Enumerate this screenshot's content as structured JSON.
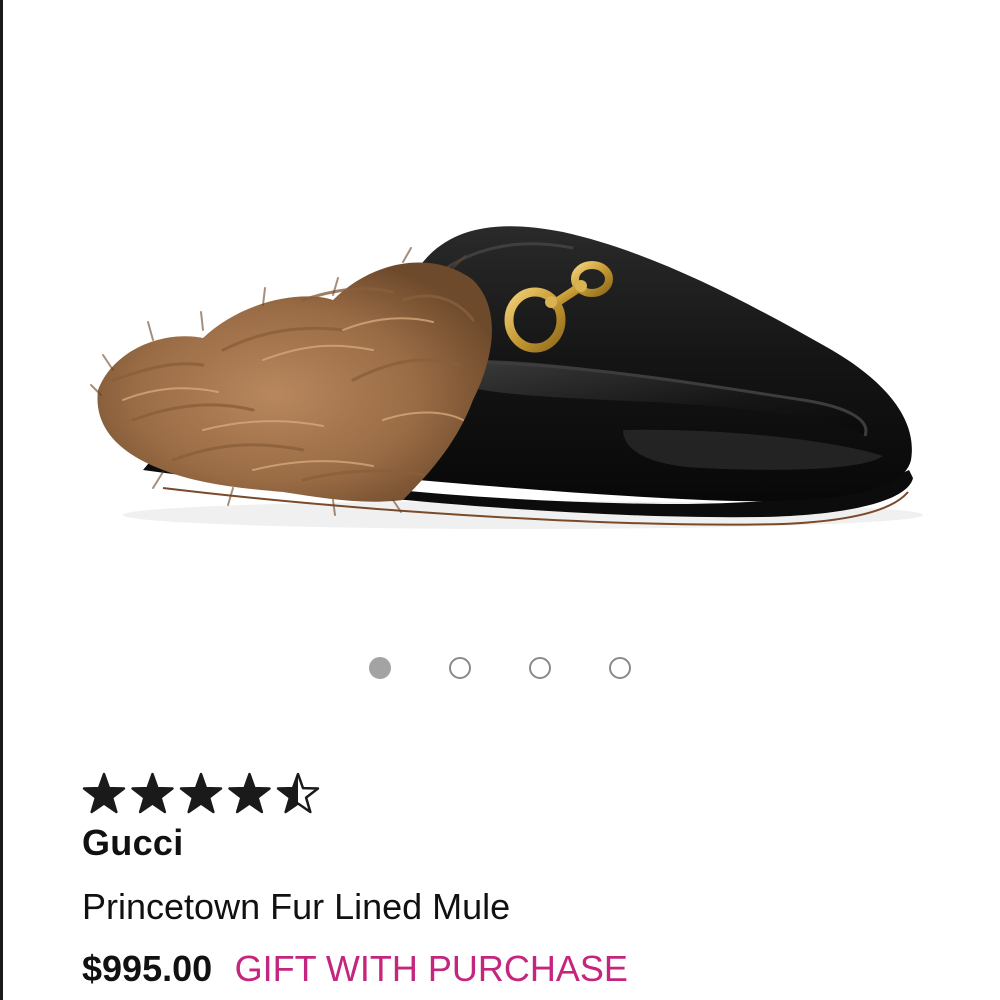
{
  "product": {
    "image_label": "Black leather loafer mule with fur lining and gold horsebit",
    "brand": "Gucci",
    "name": "Princetown Fur Lined Mule",
    "price": "$995.00",
    "promo": "GIFT WITH PURCHASE",
    "rating": 4.5,
    "rating_max": 5
  },
  "gallery": {
    "image_count": 4,
    "active_index": 0
  },
  "colors": {
    "promo": "#c4267f",
    "text": "#111111",
    "star": "#1a1a1a"
  }
}
